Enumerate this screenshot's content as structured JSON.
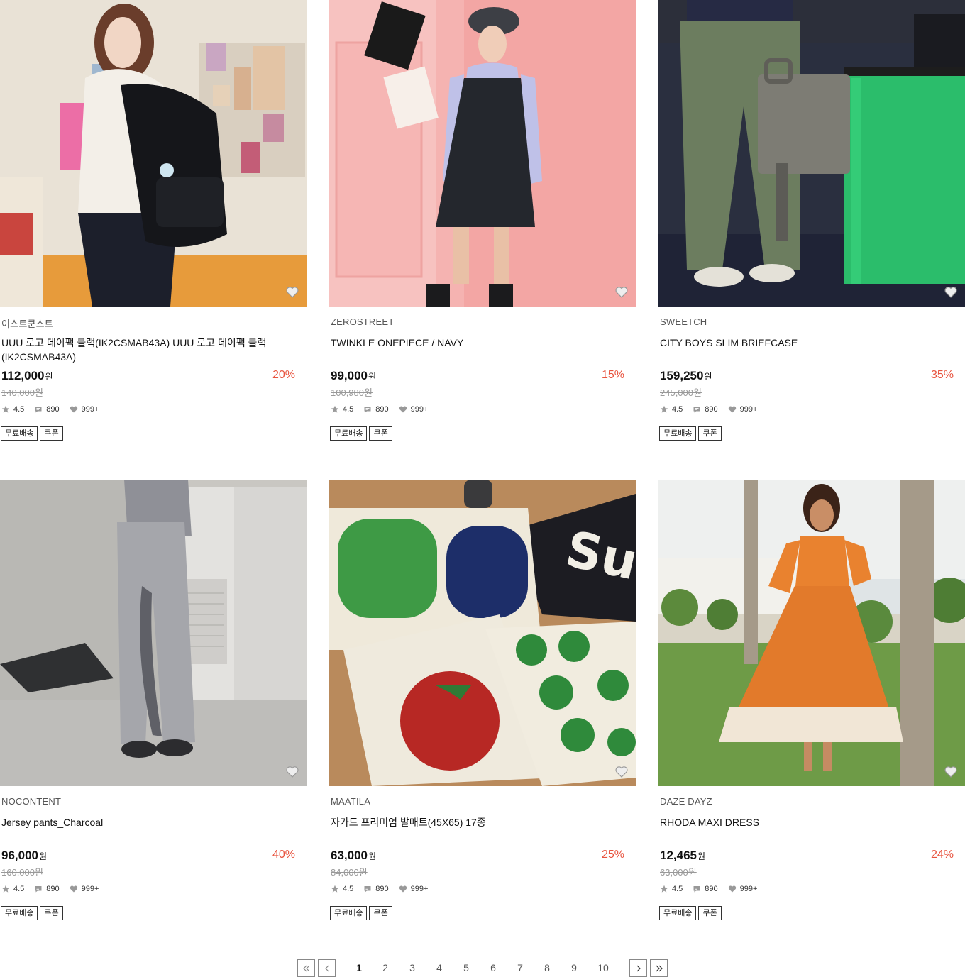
{
  "products": [
    {
      "brand": "이스트쿤스트",
      "name": "UUU 로고 데이팩 블랙(IK2CSMAB43A) UUU 로고 데이팩 블랙(IK2CSMAB43A)",
      "price": "112,000",
      "currency": "원",
      "discount": "20%",
      "original_price": "140,000원",
      "rating": "4.5",
      "reviews": "890",
      "likes": "999+",
      "tags": [
        "무료배송",
        "쿠폰"
      ]
    },
    {
      "brand": "ZEROSTREET",
      "name": "TWINKLE ONEPIECE / NAVY",
      "price": "99,000",
      "currency": "원",
      "discount": "15%",
      "original_price": "100,980원",
      "rating": "4.5",
      "reviews": "890",
      "likes": "999+",
      "tags": [
        "무료배송",
        "쿠폰"
      ]
    },
    {
      "brand": "SWEETCH",
      "name": "CITY BOYS SLIM BRIEFCASE",
      "price": "159,250",
      "currency": "원",
      "discount": "35%",
      "original_price": "245,000원",
      "rating": "4.5",
      "reviews": "890",
      "likes": "999+",
      "tags": [
        "무료배송",
        "쿠폰"
      ]
    },
    {
      "brand": "NOCONTENT",
      "name": "Jersey pants_Charcoal",
      "price": "96,000",
      "currency": "원",
      "discount": "40%",
      "original_price": "160,000원",
      "rating": "4.5",
      "reviews": "890",
      "likes": "999+",
      "tags": [
        "무료배송",
        "쿠폰"
      ]
    },
    {
      "brand": "MAATILA",
      "name": "자가드 프리미엄 발매트(45X65) 17종",
      "price": "63,000",
      "currency": "원",
      "discount": "25%",
      "original_price": "84,000원",
      "rating": "4.5",
      "reviews": "890",
      "likes": "999+",
      "tags": [
        "무료배송",
        "쿠폰"
      ]
    },
    {
      "brand": "DAZE DAYZ",
      "name": "RHODA MAXI DRESS",
      "price": "12,465",
      "currency": "원",
      "discount": "24%",
      "original_price": "63,000원",
      "rating": "4.5",
      "reviews": "890",
      "likes": "999+",
      "tags": [
        "무료배송",
        "쿠폰"
      ]
    }
  ],
  "pagination": {
    "pages": [
      "1",
      "2",
      "3",
      "4",
      "5",
      "6",
      "7",
      "8",
      "9",
      "10"
    ],
    "current": "1"
  },
  "colors": {
    "discount": "#e8533e",
    "text": "#111111",
    "muted": "#999999"
  }
}
